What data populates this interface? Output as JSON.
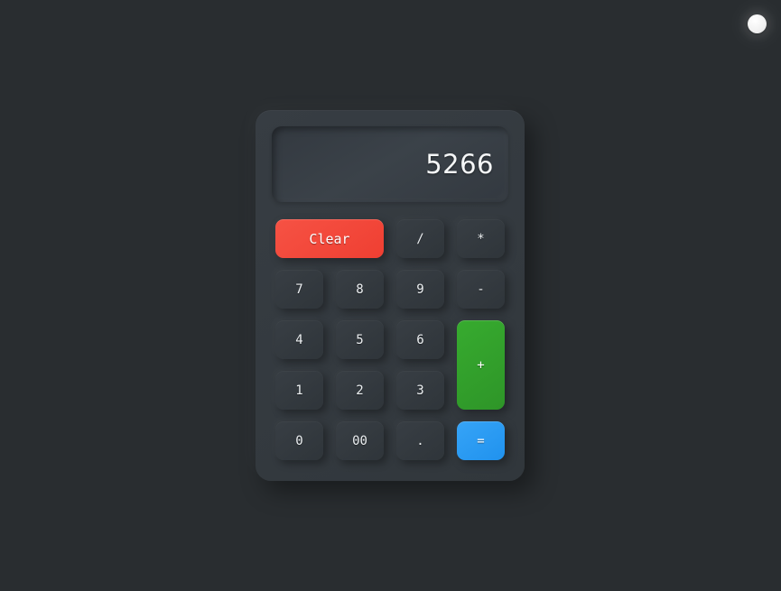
{
  "app": {
    "title": "Calculator",
    "background_color": "#292d30",
    "body_color": "#343a40"
  },
  "theme_toggle": {
    "name": "theme-toggle",
    "label": "Toggle theme",
    "state": "dark",
    "color": "#ffffff"
  },
  "display": {
    "value": "5266",
    "placeholder": "0",
    "align": "right"
  },
  "colors": {
    "accent_clear": "#f4473c",
    "accent_plus": "#33a02c",
    "accent_equals": "#2b9bf4",
    "key_face": "#343a40",
    "key_text": "#eceff1"
  },
  "keypad": {
    "rows": 5,
    "columns": 4,
    "keys": [
      {
        "label": "Clear",
        "type": "clear",
        "name": "key-clear",
        "span_cols": 2
      },
      {
        "label": "/",
        "type": "operator",
        "name": "key-divide"
      },
      {
        "label": "*",
        "type": "operator",
        "name": "key-multiply"
      },
      {
        "label": "7",
        "type": "digit",
        "name": "key-7"
      },
      {
        "label": "8",
        "type": "digit",
        "name": "key-8"
      },
      {
        "label": "9",
        "type": "digit",
        "name": "key-9"
      },
      {
        "label": "-",
        "type": "operator",
        "name": "key-minus"
      },
      {
        "label": "4",
        "type": "digit",
        "name": "key-4"
      },
      {
        "label": "5",
        "type": "digit",
        "name": "key-5"
      },
      {
        "label": "6",
        "type": "digit",
        "name": "key-6"
      },
      {
        "label": "+",
        "type": "operator",
        "name": "key-plus",
        "span_rows": 2
      },
      {
        "label": "1",
        "type": "digit",
        "name": "key-1"
      },
      {
        "label": "2",
        "type": "digit",
        "name": "key-2"
      },
      {
        "label": "3",
        "type": "digit",
        "name": "key-3"
      },
      {
        "label": "0",
        "type": "digit",
        "name": "key-0"
      },
      {
        "label": "00",
        "type": "digit",
        "name": "key-double-zero"
      },
      {
        "label": ".",
        "type": "decimal",
        "name": "key-decimal"
      },
      {
        "label": "=",
        "type": "equals",
        "name": "key-equals"
      }
    ]
  }
}
